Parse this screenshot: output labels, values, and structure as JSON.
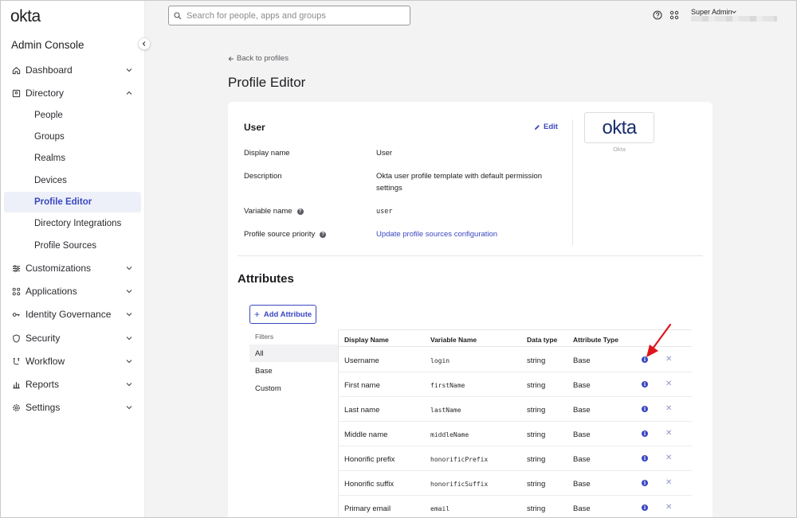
{
  "brand": {
    "logo": "okta",
    "console_title": "Admin Console"
  },
  "search": {
    "placeholder": "Search for people, apps and groups"
  },
  "topbar": {
    "user_role": "Super Admin"
  },
  "sidebar": {
    "items": [
      {
        "label": "Dashboard",
        "icon": "home-icon"
      },
      {
        "label": "Directory",
        "icon": "directory-icon"
      },
      {
        "label": "Customizations",
        "icon": "sliders-icon"
      },
      {
        "label": "Applications",
        "icon": "apps-grid-icon"
      },
      {
        "label": "Identity Governance",
        "icon": "key-icon"
      },
      {
        "label": "Security",
        "icon": "shield-icon"
      },
      {
        "label": "Workflow",
        "icon": "workflow-icon"
      },
      {
        "label": "Reports",
        "icon": "bar-chart-icon"
      },
      {
        "label": "Settings",
        "icon": "gear-icon"
      }
    ],
    "directory_sub": [
      "People",
      "Groups",
      "Realms",
      "Devices",
      "Profile Editor",
      "Directory Integrations",
      "Profile Sources"
    ],
    "active_sub": "Profile Editor"
  },
  "main": {
    "back_link": "Back to profiles",
    "title": "Profile Editor",
    "profile": {
      "heading": "User",
      "edit_label": "Edit",
      "rows": [
        {
          "label": "Display name",
          "value": "User"
        },
        {
          "label": "Description",
          "value": "Okta user profile template with default permission settings"
        },
        {
          "label": "Variable name",
          "value": "user"
        },
        {
          "label": "Profile source priority",
          "value": "Update profile sources configuration"
        }
      ],
      "app_logo": "okta",
      "app_caption": "Okta"
    },
    "attributes": {
      "title": "Attributes",
      "add_label": "Add Attribute",
      "filters_label": "Filters",
      "filters": [
        "All",
        "Base",
        "Custom"
      ],
      "active_filter": "All",
      "columns": [
        "Display Name",
        "Variable Name",
        "Data type",
        "Attribute Type"
      ],
      "rows": [
        {
          "display": "Username",
          "variable": "login",
          "type": "string",
          "attr_type": "Base"
        },
        {
          "display": "First name",
          "variable": "firstName",
          "type": "string",
          "attr_type": "Base"
        },
        {
          "display": "Last name",
          "variable": "lastName",
          "type": "string",
          "attr_type": "Base"
        },
        {
          "display": "Middle name",
          "variable": "middleName",
          "type": "string",
          "attr_type": "Base"
        },
        {
          "display": "Honorific prefix",
          "variable": "honorificPrefix",
          "type": "string",
          "attr_type": "Base"
        },
        {
          "display": "Honorific suffix",
          "variable": "honorificSuffix",
          "type": "string",
          "attr_type": "Base"
        },
        {
          "display": "Primary email",
          "variable": "email",
          "type": "string",
          "attr_type": "Base"
        }
      ]
    }
  },
  "colors": {
    "accent": "#3a47c0",
    "annotation_arrow": "#e0141c"
  }
}
